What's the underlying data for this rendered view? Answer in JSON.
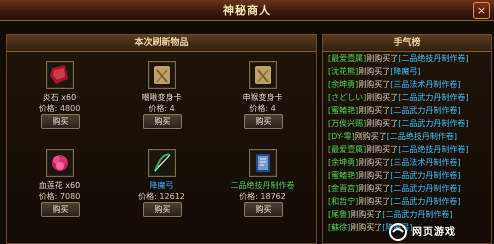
{
  "window": {
    "title": "神秘商人",
    "close_glyph": "×"
  },
  "shop": {
    "title": "本次刷新物品",
    "items": [
      {
        "name": "炎石 x60",
        "price_label": "价格:",
        "price": "4800",
        "buy_label": "购买",
        "icon": "red-stone-icon",
        "accent": "#c81f35"
      },
      {
        "name": "嘲啾变身卡",
        "price_label": "价格:",
        "price": "4",
        "buy_label": "购买",
        "icon": "scroll-card-icon",
        "accent": "#c8a96d"
      },
      {
        "name": "申猴变身卡",
        "price_label": "价格:",
        "price": "4",
        "buy_label": "购买",
        "icon": "scroll-card-icon",
        "accent": "#c8a96d"
      },
      {
        "name": "血莲花 x60",
        "price_label": "价格:",
        "price": "7080",
        "buy_label": "购买",
        "icon": "blood-lotus-icon",
        "accent": "#e8357f"
      },
      {
        "name": "降魔弓",
        "price_label": "价格:",
        "price": "12612",
        "buy_label": "购买",
        "icon": "bow-icon",
        "accent": "#29a54f"
      },
      {
        "name": "二品绝技丹制作卷",
        "price_label": "价格:",
        "price": "18762",
        "buy_label": "购买",
        "icon": "recipe-scroll-icon",
        "accent": "#3d6ab3"
      }
    ]
  },
  "log": {
    "title": "手气榜",
    "entries": [
      {
        "player": "[最爱壹属]",
        "action": "刚购买了",
        "item": "[二品绝技丹制作卷]"
      },
      {
        "player": "[沈花熊]",
        "action": "刚购买了",
        "item": "[降魔弓]"
      },
      {
        "player": "[余坤勇]",
        "action": "刚购买了",
        "item": "[三品法术丹制作卷]"
      },
      {
        "player": "[さどしい]",
        "action": "刚购买了",
        "item": "[二品武力丹制作卷]"
      },
      {
        "player": "[蜜鳍艳]",
        "action": "刚购买了",
        "item": "[二品武力丹制作卷]"
      },
      {
        "player": "[万俟兴赐]",
        "action": "刚购买了",
        "item": "[二品武力丹制作卷]"
      },
      {
        "player": "[DY-零]",
        "action": "刚购买了",
        "item": "[二品绝技丹制作卷]"
      },
      {
        "player": "[最爱壹属]",
        "action": "刚购买了",
        "item": "[二品绝技丹制作卷]"
      },
      {
        "player": "[余坤勇]",
        "action": "刚购买了",
        "item": "[三品法术丹制作卷]"
      },
      {
        "player": "[蜜鳍艳]",
        "action": "刚购买了",
        "item": "[二品武力丹制作卷]"
      },
      {
        "player": "[金晋宫]",
        "action": "刚购买了",
        "item": "[二品武力丹制作卷]"
      },
      {
        "player": "[和哲宁]",
        "action": "刚购买了",
        "item": "[二品武力丹制作卷]"
      },
      {
        "player": "[尾鲁]",
        "action": "刚购买了",
        "item": "[二品武力丹制作卷]"
      },
      {
        "player": "[蘇徐]",
        "action": "刚购买了",
        "item": "[降魔弓]"
      }
    ]
  },
  "watermark": {
    "text": "网页游戏"
  },
  "colors": {
    "title_text": "#f7e7b0",
    "player_green": "#52d65a",
    "item_blue": "#40c0ff",
    "frame_gold": "#6b4a27"
  }
}
